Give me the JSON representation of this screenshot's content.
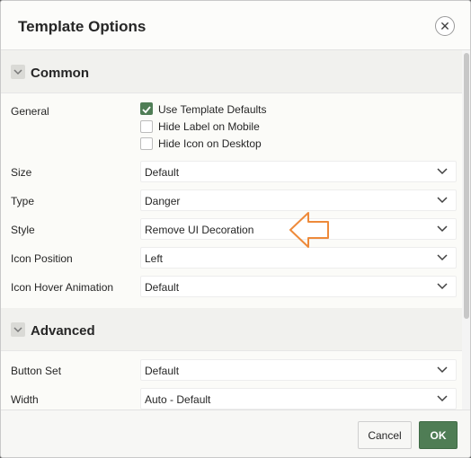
{
  "dialog": {
    "title": "Template Options",
    "close_label": "✕"
  },
  "common": {
    "title": "Common",
    "general": {
      "label": "General",
      "checkboxes": [
        {
          "label": "Use Template Defaults",
          "checked": true
        },
        {
          "label": "Hide Label on Mobile",
          "checked": false
        },
        {
          "label": "Hide Icon on Desktop",
          "checked": false
        }
      ]
    },
    "fields": [
      {
        "label": "Size",
        "value": "Default"
      },
      {
        "label": "Type",
        "value": "Danger"
      },
      {
        "label": "Style",
        "value": "Remove UI Decoration"
      },
      {
        "label": "Icon Position",
        "value": "Left"
      },
      {
        "label": "Icon Hover Animation",
        "value": "Default"
      }
    ]
  },
  "advanced": {
    "title": "Advanced",
    "fields": [
      {
        "label": "Button Set",
        "value": "Default"
      },
      {
        "label": "Width",
        "value": "Auto - Default"
      }
    ]
  },
  "footer": {
    "cancel_label": "Cancel",
    "ok_label": "OK"
  },
  "colors": {
    "accent": "#4f7d55",
    "annotation_arrow": "#ee8a3a"
  },
  "icons": {
    "close": "close-icon",
    "collapse": "chevron-down-icon",
    "select": "chevron-down-icon",
    "checkbox": "checkmark-icon",
    "annotation": "left-arrow-icon"
  }
}
